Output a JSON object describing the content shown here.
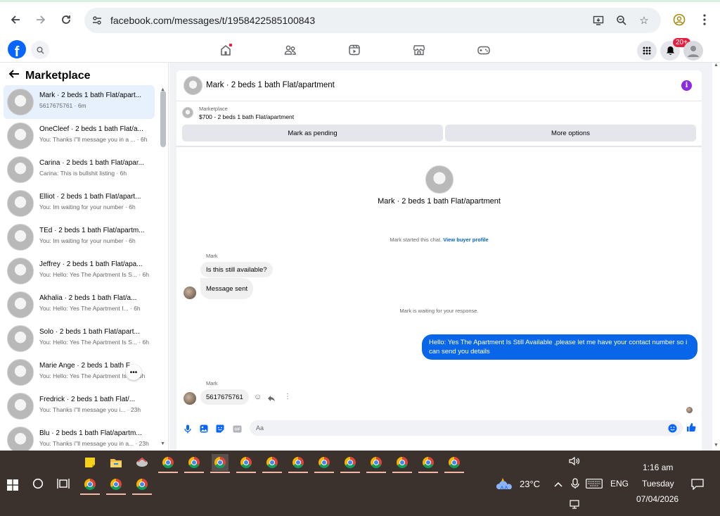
{
  "browser": {
    "url": "facebook.com/messages/t/1958422585100843"
  },
  "header": {
    "logo_letter": "f",
    "notification_badge": "20+"
  },
  "sidebar": {
    "title": "Marketplace",
    "conversations": [
      {
        "name": "Mark · 2 beds 1 bath Flat/apart...",
        "sub": "5617675761 · 6m"
      },
      {
        "name": "OneCleef · 2 beds 1 bath Flat/a...",
        "sub": "You: Thanks i''ll message you in a ... · 6h"
      },
      {
        "name": "Carina · 2 beds 1 bath Flat/apar...",
        "sub": "Carina: This is bullshit listing · 6h"
      },
      {
        "name": "Elliot · 2 beds 1 bath Flat/apart...",
        "sub": "You: Im waiting for your number · 6h"
      },
      {
        "name": "TEd · 2 beds 1 bath Flat/apartm...",
        "sub": "You: Im waiting for your number · 6h"
      },
      {
        "name": "Jeffrey · 2 beds 1 bath Flat/apa...",
        "sub": "You: Hello: Yes The Apartment Is S... · 6h"
      },
      {
        "name": "Akhalia · 2 beds 1 bath Flat/a...",
        "sub": "You: Hello: Yes The Apartment I... · 6h"
      },
      {
        "name": "Solo · 2 beds 1 bath Flat/apart...",
        "sub": "You: Hello: Yes The Apartment Is S... · 6h"
      },
      {
        "name": "Marie Ange · 2 beds 1 bath F...",
        "sub": "You: Hello: Yes The Apartment Is ... · 6h"
      },
      {
        "name": "Fredrick · 2 beds 1 bath Flat/...",
        "sub": "You: Thanks i''ll message you i... · 23h"
      },
      {
        "name": "Blu · 2 beds 1 bath Flat/apartm...",
        "sub": "You: Thanks i''ll message you in a... · 23h"
      }
    ]
  },
  "chat": {
    "title": "Mark · 2 beds 1 bath Flat/apartment",
    "marketplace_label": "Marketplace",
    "listing": "$700 - 2 beds 1 bath Flat/apartment",
    "mark_pending_label": "Mark as pending",
    "more_options_label": "More options",
    "center_title": "Mark · 2 beds 1 bath Flat/apartment",
    "started_note": "Mark started this chat.",
    "view_profile_link": "View buyer profile",
    "sender_name": "Mark",
    "msg_1": "Is this still available?",
    "msg_2": "Message sent",
    "waiting_note": "Mark is waiting for your response.",
    "msg_out": "Hello: Yes The Apartment Is Still Available ,please let me have your contact number so i can send you details",
    "sender_name_2": "Mark",
    "msg_3": "5617675761",
    "input_placeholder": "Aa"
  },
  "taskbar": {
    "weather": "23°C",
    "language": "ENG",
    "time": "1:16 am",
    "day": "Tuesday",
    "date": "07/04/2026"
  },
  "colors": {
    "fb_blue": "#0866ff",
    "outgoing_bubble": "#0a66e8",
    "taskbar": "#3b322e",
    "badge_red": "#e41e3f"
  }
}
